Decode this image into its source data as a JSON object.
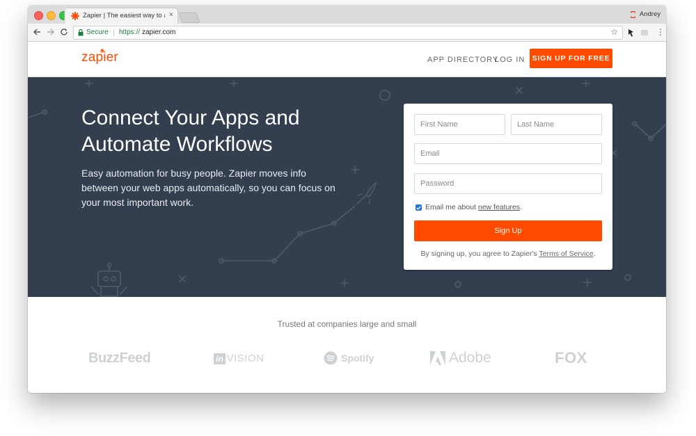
{
  "browser": {
    "tab_title": "Zapier | The easiest way to aut",
    "tab_close": "×",
    "user_name": "Andrey",
    "secure_label": "Secure",
    "url_scheme": "https://",
    "url_host": "zapier.com"
  },
  "header": {
    "logo_text": "zapier",
    "nav": {
      "app_directory": "APP DIRECTORY",
      "log_in": "LOG IN",
      "sign_up": "SIGN UP FOR FREE"
    }
  },
  "hero": {
    "title": "Connect Your Apps and Automate Workflows",
    "description": "Easy automation for busy people. Zapier moves info between your web apps automatically, so you can focus on your most important work."
  },
  "signup_form": {
    "first_name_placeholder": "First Name",
    "last_name_placeholder": "Last Name",
    "email_placeholder": "Email",
    "password_placeholder": "Password",
    "email_opt_in_checked": true,
    "email_opt_in_prefix": "Email me about ",
    "email_opt_in_link": "new features",
    "email_opt_in_suffix": ".",
    "submit_label": "Sign Up",
    "terms_prefix": "By signing up, you agree to Zapier's ",
    "terms_link": "Terms of Service",
    "terms_suffix": "."
  },
  "trusted": {
    "title": "Trusted at companies large and small",
    "brands": {
      "buzzfeed": "BuzzFeed",
      "invision_in": "in",
      "invision_rest": "VISION",
      "spotify": "Spotify",
      "adobe": "Adobe",
      "fox": "FOX"
    }
  },
  "colors": {
    "brand_orange": "#ff4a00",
    "hero_bg": "#333f4e",
    "checkbox_blue": "#1f75d8"
  },
  "icons": {
    "back": "back-arrow-icon",
    "forward": "forward-arrow-icon",
    "reload": "reload-icon",
    "lock": "lock-icon",
    "bookmark": "star-icon",
    "menu": "menu-dots-icon",
    "favicon": "zapier-favicon-icon"
  }
}
